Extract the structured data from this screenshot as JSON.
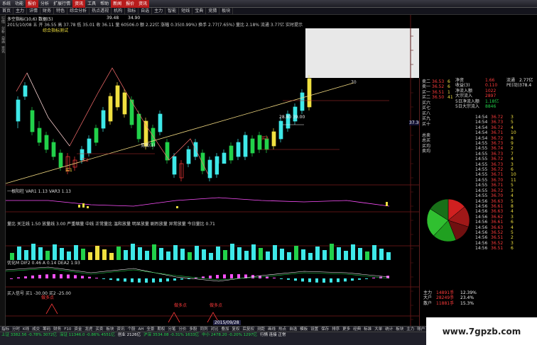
{
  "menubar": {
    "items": [
      "系统",
      "功能",
      "报价",
      "分析",
      "扩展行情",
      "资讯",
      "工具",
      "帮助"
    ],
    "hot": [
      "新闻",
      "报价",
      "资讯"
    ]
  },
  "toolbar": {
    "items": [
      "首页",
      "主力",
      "详情",
      "财务",
      "特色",
      "综合分析",
      "热点透视",
      "机构",
      "指标",
      "自选",
      "主力",
      "智能",
      "短线",
      "宝典",
      "竞猜",
      "板块"
    ]
  },
  "leftstrip": [
    "行情",
    "分析",
    "自选",
    "资讯"
  ],
  "chart": {
    "header_line1": "多空指标(10,6) 数据(5)",
    "header_line2": "2015/10/08 五 开 36.55 高 37.78 低 35.01 收 36.11 量 60506.0 额 2.22亿 涨幅 0.35(0.99%) 换手 2.77(7.65%) 量比 2.18% 流通 3.77亿 实时提示",
    "title_small": "综合指标测试",
    "price_labels": {
      "high": "39.48",
      "hl2": "34.90",
      "mid": "28.80 39.00",
      "right_price": "37.30"
    },
    "annotations": [
      "买1",
      "买2",
      "买3",
      "卖1",
      "卖2",
      "见底(1)",
      "突破"
    ],
    "x_date": "2015/09/28",
    "panel1_label": "一根阳柱 VAR1 1.13 VAR3 1.13",
    "panel2_label": "量比 关注线 1.50 放量线 3.00 严重缩量 中线 正常量比 温和放量 明显放量 剧烈放量 异常放量 今日量比 0.71",
    "panel3_label": "优化M DIF2 0.46 A 0.14 DEA2 1.93",
    "panel4_label": "买入信号 买1 -30.00 买2 -25.00",
    "panel4_marks": [
      "做多点",
      "做多点",
      "做多点"
    ],
    "slope_end_label": "70"
  },
  "quotes": {
    "sell": [
      {
        "label": "卖二",
        "price": "36.53",
        "vol": "6"
      },
      {
        "label": "卖一",
        "price": "36.52",
        "vol": "6"
      }
    ],
    "buy": [
      {
        "label": "买一",
        "price": "36.51",
        "vol": "1"
      },
      {
        "label": "买二",
        "price": "36.50",
        "vol": "41"
      }
    ],
    "stats_left": [
      {
        "label": "净资",
        "value": "1.66"
      },
      {
        "label": "收益(3)",
        "value": "0.110"
      },
      {
        "label": "净流入额",
        "value": "1022"
      },
      {
        "label": "大宗流入",
        "value": "2897"
      },
      {
        "label": "5日净流入额",
        "value": "1.18亿"
      },
      {
        "label": "5日大宗流入",
        "value": "8846"
      }
    ],
    "stats_right": [
      {
        "label": "流通",
        "value": "2.77亿"
      },
      {
        "label": "PE(动)",
        "value": "378.4"
      }
    ],
    "buy_levels": [
      "买六",
      "买七",
      "买八",
      "买九",
      "买十"
    ],
    "mid_labels": [
      "总卖",
      "总买",
      "买均",
      "卖均"
    ],
    "ticks": [
      {
        "time": "14:54",
        "price": "36.72",
        "vol": "3"
      },
      {
        "time": "14:54",
        "price": "36.73",
        "vol": "5"
      },
      {
        "time": "14:54",
        "price": "36.72",
        "vol": "4"
      },
      {
        "time": "14:54",
        "price": "36.71",
        "vol": "10"
      },
      {
        "time": "14:54",
        "price": "36.72",
        "vol": "8"
      },
      {
        "time": "14:55",
        "price": "36.73",
        "vol": "9"
      },
      {
        "time": "14:55",
        "price": "36.74",
        "vol": "2"
      },
      {
        "time": "14:55",
        "price": "36.73",
        "vol": "7"
      },
      {
        "time": "14:55",
        "price": "36.72",
        "vol": "4"
      },
      {
        "time": "14:55",
        "price": "36.73",
        "vol": "3"
      },
      {
        "time": "14:55",
        "price": "36.72",
        "vol": "6"
      },
      {
        "time": "14:55",
        "price": "36.71",
        "vol": "10"
      },
      {
        "time": "14:55",
        "price": "36.70",
        "vol": "11"
      },
      {
        "time": "14:55",
        "price": "36.71",
        "vol": "5"
      },
      {
        "time": "14:55",
        "price": "36.72",
        "vol": "3"
      },
      {
        "time": "14:55",
        "price": "36.70",
        "vol": "4"
      },
      {
        "time": "14:56",
        "price": "36.63",
        "vol": "5"
      },
      {
        "time": "14:56",
        "price": "36.61",
        "vol": "8"
      },
      {
        "time": "14:56",
        "price": "36.63",
        "vol": "4"
      },
      {
        "time": "14:56",
        "price": "36.62",
        "vol": "3"
      },
      {
        "time": "14:56",
        "price": "36.61",
        "vol": "6"
      },
      {
        "time": "14:56",
        "price": "36.63",
        "vol": "4"
      },
      {
        "time": "14:56",
        "price": "36.52",
        "vol": "5"
      },
      {
        "time": "14:56",
        "price": "36.51",
        "vol": "2"
      },
      {
        "time": "14:56",
        "price": "36.52",
        "vol": "3"
      },
      {
        "time": "14:56",
        "price": "36.51",
        "vol": "6"
      }
    ],
    "flow_rows": [
      {
        "label": "主力",
        "value": "14891手",
        "pct": "12.39%"
      },
      {
        "label": "大户",
        "value": "28249手",
        "pct": "23.4%"
      },
      {
        "label": "散户",
        "value": "11881手",
        "pct": "15.3%"
      }
    ],
    "tab_label": "日线"
  },
  "tabs": [
    "指标",
    "分时",
    "K线",
    "成交",
    "筹码",
    "财务",
    "F10",
    "资金",
    "龙虎",
    "买卖",
    "板块",
    "资讯",
    "个股",
    "AH",
    "全景",
    "期权",
    "分笔",
    "分价",
    "多股",
    "同列",
    "对比",
    "叠加",
    "复权",
    "后复权",
    "测距",
    "画线",
    "热点",
    "自选",
    "模板",
    "设置",
    "保存",
    "排序",
    "更多",
    "经典",
    "标准",
    "大单",
    "统计",
    "板块",
    "主力",
    "账户",
    "选股"
  ],
  "status": {
    "sh": "上证 3382.56 -0.78% 3072亿",
    "sz": "深证 11346.0 -0.86% 4551亿",
    "cy": "创业 2126亿",
    "hs300": "沪深 3534.08 -0.31% 1633亿",
    "zx": "中小 2478.20 -0.20% 1297亿",
    "extra": "行情 连接 正常"
  },
  "site": "www.7gpzb.com",
  "colors": {
    "up": "#ff3b3b",
    "down": "#22d14a",
    "yellow": "#f0e040",
    "cyan": "#3ee8e8"
  }
}
